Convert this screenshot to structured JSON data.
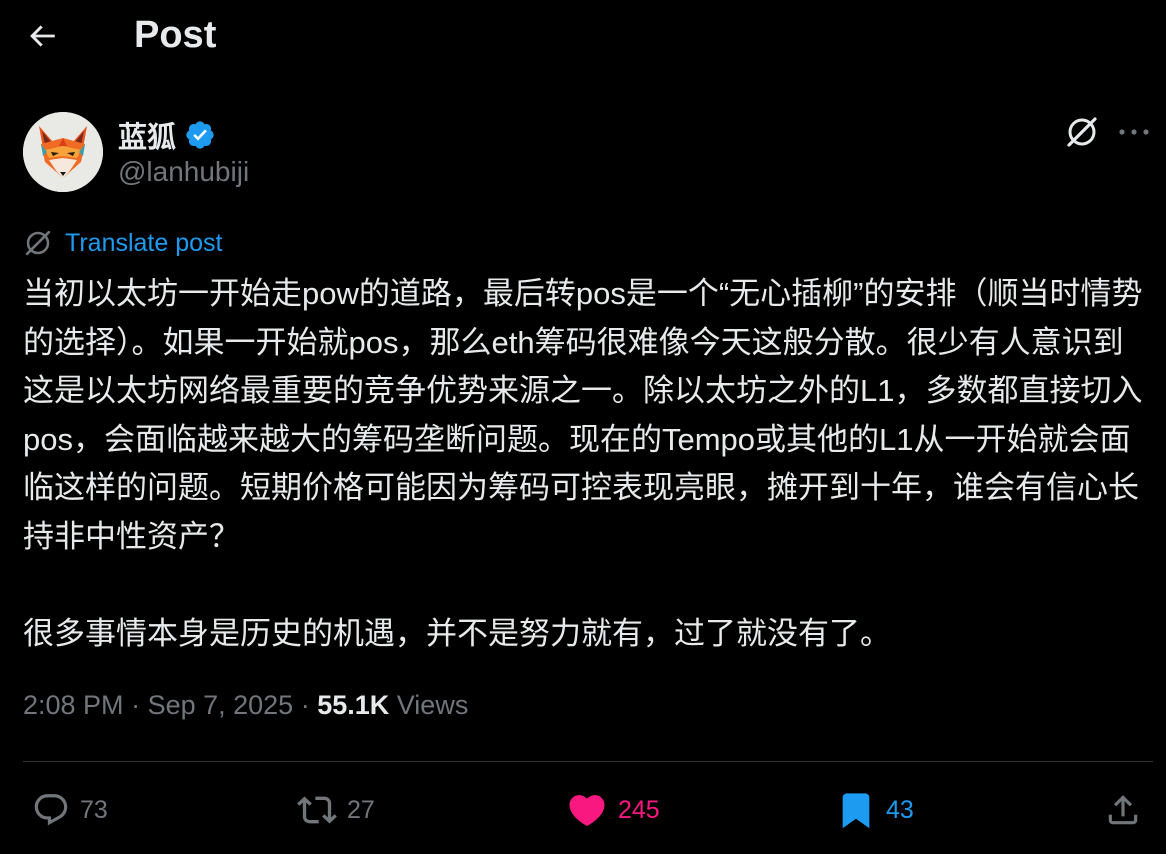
{
  "header": {
    "title": "Post",
    "back_icon": "arrow-left-icon"
  },
  "author": {
    "display_name": "蓝狐",
    "handle": "@lanhubiji",
    "verified": true,
    "verified_color": "#1d9bf0",
    "avatar_icon": "fox-avatar"
  },
  "top_actions": {
    "grok_icon": "grok-icon",
    "more_icon": "more-horizontal-icon"
  },
  "translate": {
    "label": "Translate post",
    "color": "#1d9bf0"
  },
  "post": {
    "paragraphs": [
      "当初以太坊一开始走pow的道路，最后转pos是一个“无心插柳”的安排（顺当时情势的选择）。如果一开始就pos，那么eth筹码很难像今天这般分散。很少有人意识到这是以太坊网络最重要的竞争优势来源之一。除以太坊之外的L1，多数都直接切入pos，会面临越来越大的筹码垄断问题。现在的Tempo或其他的L1从一开始就会面临这样的问题。短期价格可能因为筹码可控表现亮眼，摊开到十年，谁会有信心长持非中性资产？",
      "很多事情本身是历史的机遇，并不是努力就有，过了就没有了。"
    ]
  },
  "meta": {
    "time": "2:08 PM",
    "separator": " · ",
    "date": "Sep 7, 2025",
    "views_count": "55.1K",
    "views_label": "Views"
  },
  "actions": {
    "reply": {
      "count": "73",
      "icon": "reply-icon"
    },
    "repost": {
      "count": "27",
      "icon": "repost-icon"
    },
    "like": {
      "count": "245",
      "icon": "heart-icon",
      "active": true,
      "color": "#f91880"
    },
    "bookmark": {
      "count": "43",
      "icon": "bookmark-icon",
      "active": true,
      "color": "#1d9bf0"
    },
    "share": {
      "icon": "share-icon"
    }
  },
  "colors": {
    "background": "#000000",
    "text": "#e7e9ea",
    "muted": "#71767b",
    "divider": "#2f3336"
  }
}
